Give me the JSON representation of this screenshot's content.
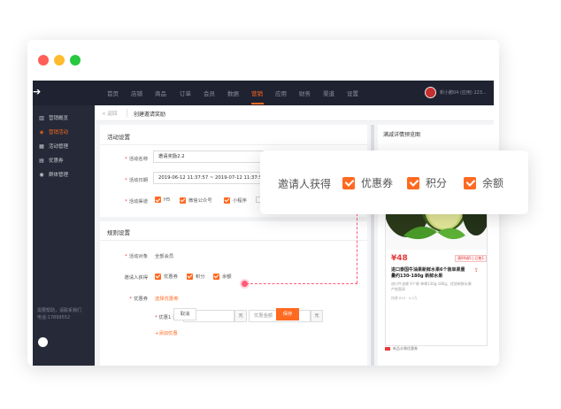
{
  "topnav": {
    "items": [
      "首页",
      "店铺",
      "商品",
      "订单",
      "会员",
      "数据",
      "营销",
      "应用",
      "财务",
      "渠道",
      "设置"
    ],
    "active_index": 6,
    "user_text": "新小鹏04 (应用) 223..."
  },
  "sidebar": {
    "items": [
      {
        "label": "营销概览",
        "icon": "chart-icon"
      },
      {
        "label": "营销活动",
        "icon": "tag-icon"
      },
      {
        "label": "活动管理",
        "icon": "grid-icon"
      },
      {
        "label": "优惠券",
        "icon": "coupon-icon"
      },
      {
        "label": "群体管理",
        "icon": "users-icon"
      }
    ],
    "active_index": 1,
    "help_line1": "需要帮助，请联系我们",
    "help_line2": "电话:17899552"
  },
  "breadcrumb": {
    "back": "< 返回",
    "title": "创建邀请奖励"
  },
  "activity": {
    "section_title": "活动设置",
    "name_label": "活动名称",
    "name_value": "邀请奖励2.2",
    "date_label": "活动日期",
    "date_value": "2019-06-12 11:37:57 ~ 2019-07-12 11:37:57",
    "channel_label": "活动渠道",
    "channels": [
      {
        "label": "H5",
        "checked": true
      },
      {
        "label": "微信公众号",
        "checked": true
      },
      {
        "label": "小程序",
        "checked": true
      },
      {
        "label": "A",
        "checked": false
      }
    ]
  },
  "rules": {
    "section_title": "规则设置",
    "target_label": "活动对象",
    "target_value": "全部会员",
    "reward_label": "邀请人获得",
    "rewards": [
      {
        "label": "优惠券",
        "checked": true
      },
      {
        "label": "积分",
        "checked": true
      },
      {
        "label": "余额",
        "checked": true
      }
    ],
    "coupon_label": "优惠券",
    "coupon_link": "选择优惠券",
    "coupon_item_label": "优惠1 消费满",
    "unit1": "元",
    "coupon_amount_placeholder": "优惠金额",
    "unit2": "元",
    "add_coupon": "+添加优惠"
  },
  "actions": {
    "cancel": "取消",
    "save": "保存"
  },
  "preview": {
    "title": "满减详情预览图",
    "price": "¥48",
    "price_tag": "满99减5 | 已售1",
    "product_title": "进口泰国牛油果新鲜水果6个装单果重量约130-180g 新鲜水果",
    "product_sub": "进口牛油果 6个装 单果130g-180g，优质新鲜水果 产地直采",
    "small_text": "快递 ¥10 · 4.2万",
    "footer": "新品水果优惠券"
  },
  "popup": {
    "label": "邀请人获得",
    "options": [
      "优惠券",
      "积分",
      "余额"
    ]
  },
  "colors": {
    "accent": "#ff6a21",
    "nav_bg": "#1f2230",
    "sidebar_bg": "#262a38",
    "marker": "#ff5b7a"
  }
}
